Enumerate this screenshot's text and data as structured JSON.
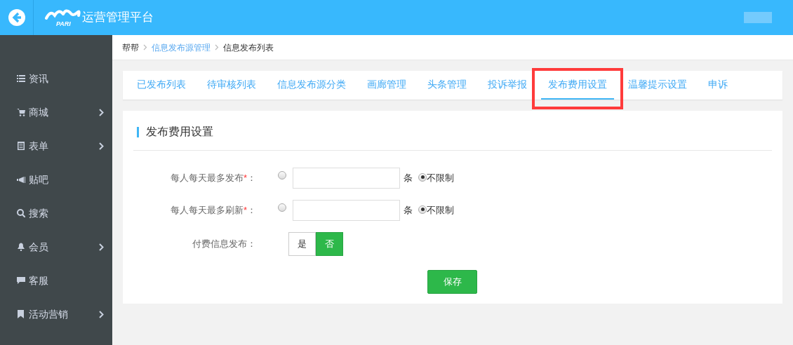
{
  "header": {
    "title": "运营管理平台",
    "logo_text": "PARI"
  },
  "sidebar": {
    "items": [
      {
        "label": "资讯",
        "has_children": false
      },
      {
        "label": "商城",
        "has_children": true
      },
      {
        "label": "表单",
        "has_children": true
      },
      {
        "label": "贴吧",
        "has_children": false
      },
      {
        "label": "搜索",
        "has_children": false
      },
      {
        "label": "会员",
        "has_children": true
      },
      {
        "label": "客服",
        "has_children": false
      },
      {
        "label": "活动营销",
        "has_children": true
      }
    ]
  },
  "breadcrumb": [
    {
      "label": "帮帮",
      "link": false
    },
    {
      "label": "信息发布源管理",
      "link": true
    },
    {
      "label": "信息发布列表",
      "link": false
    }
  ],
  "tabs": [
    {
      "label": "已发布列表",
      "selected": false,
      "highlighted": false
    },
    {
      "label": "待审核列表",
      "selected": false,
      "highlighted": false
    },
    {
      "label": "信息发布源分类",
      "selected": false,
      "highlighted": false
    },
    {
      "label": "画廊管理",
      "selected": false,
      "highlighted": false
    },
    {
      "label": "头条管理",
      "selected": false,
      "highlighted": false
    },
    {
      "label": "投诉举报",
      "selected": false,
      "highlighted": false
    },
    {
      "label": "发布费用设置",
      "selected": true,
      "highlighted": true
    },
    {
      "label": "温馨提示设置",
      "selected": false,
      "highlighted": false
    },
    {
      "label": "申诉",
      "selected": false,
      "highlighted": false
    }
  ],
  "panel": {
    "title": "发布费用设置",
    "fields": [
      {
        "kind": "limit",
        "label": "每人每天最多发布",
        "required_mark": "*",
        "colon": "：",
        "limited": false,
        "unit": "条",
        "unlimited_label": "不限制"
      },
      {
        "kind": "limit",
        "label": "每人每天最多刷新",
        "required_mark": "*",
        "colon": "：",
        "limited": false,
        "unit": "条",
        "unlimited_label": "不限制"
      },
      {
        "kind": "toggle",
        "label": "付费信息发布",
        "colon": "：",
        "options": [
          {
            "label": "是",
            "selected": false
          },
          {
            "label": "否",
            "selected": true
          }
        ]
      }
    ],
    "save_button": "保存"
  }
}
